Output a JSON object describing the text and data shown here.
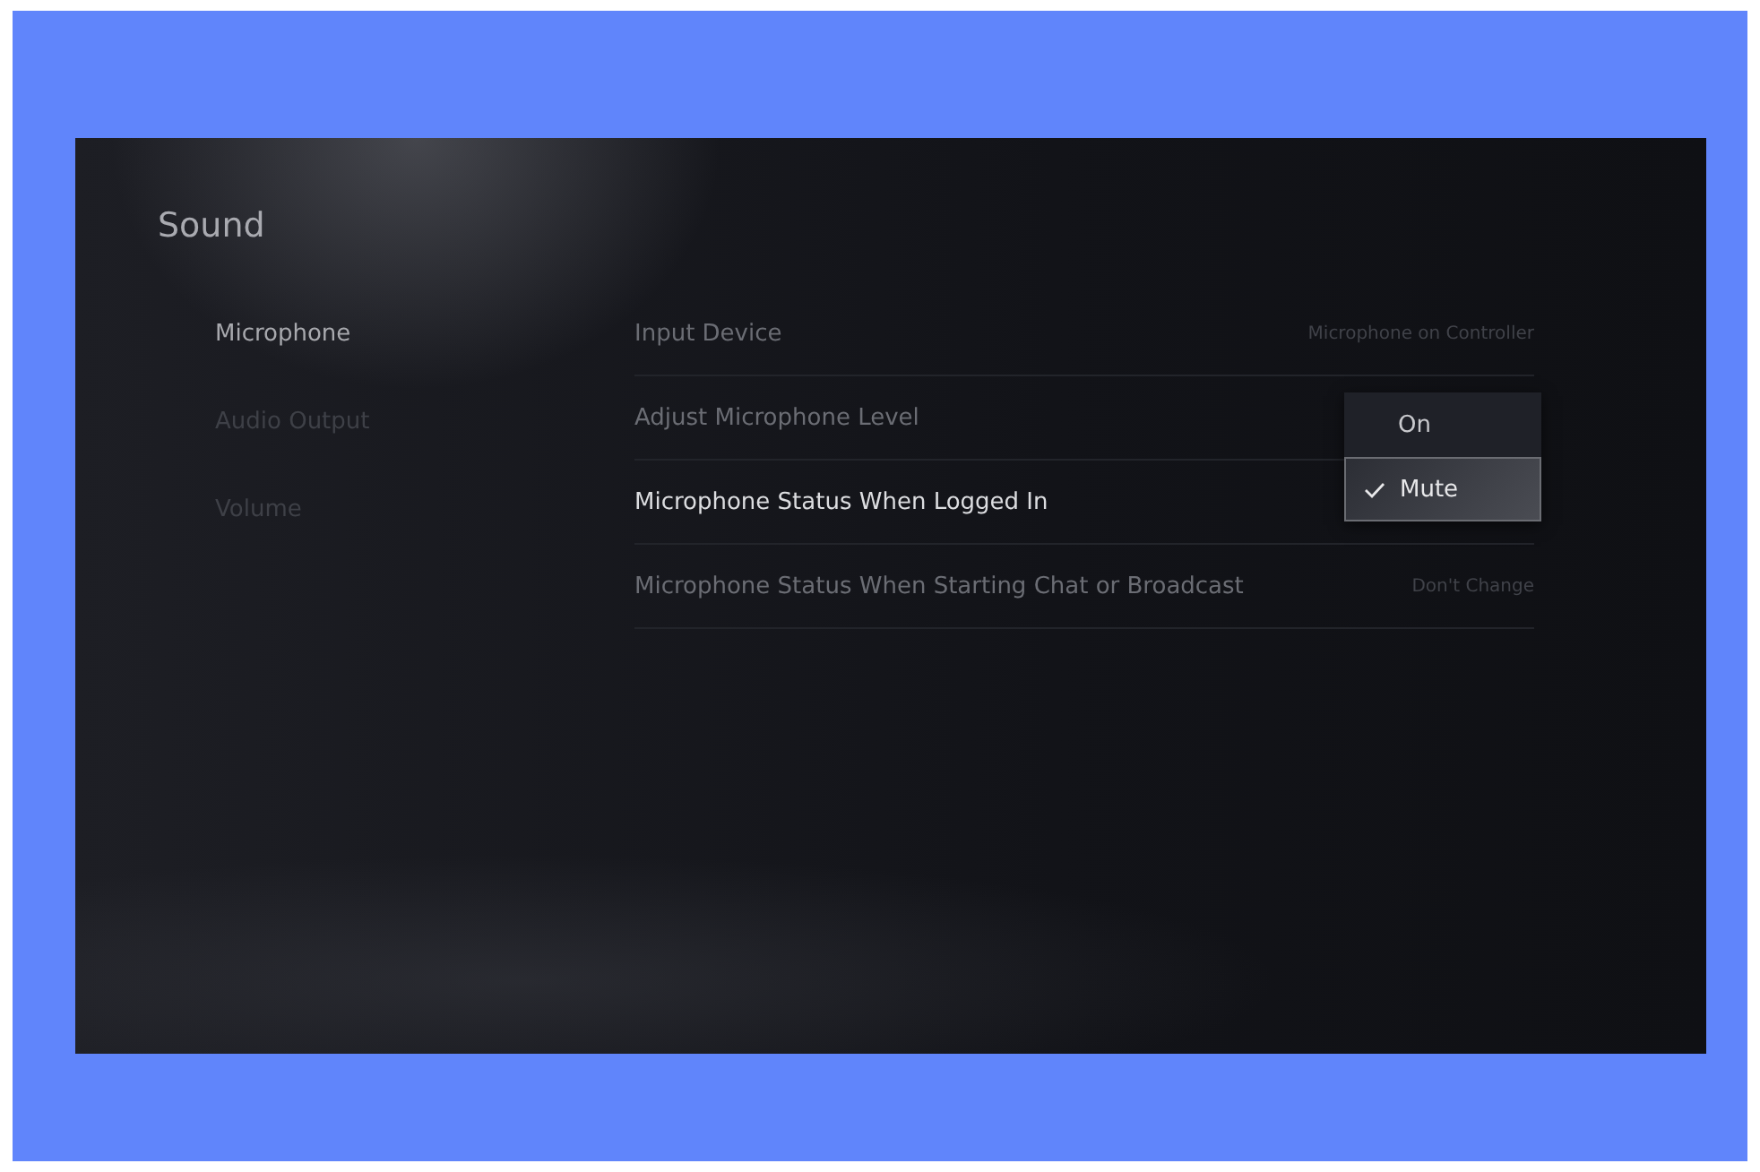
{
  "screen": {
    "title": "Sound"
  },
  "sidebar": {
    "items": [
      {
        "label": "Microphone",
        "selected": true
      },
      {
        "label": "Audio Output",
        "selected": false
      },
      {
        "label": "Volume",
        "selected": false
      }
    ]
  },
  "settings": [
    {
      "label": "Input Device",
      "value": "Microphone on Controller",
      "selected": false
    },
    {
      "label": "Adjust Microphone Level",
      "selected": false
    },
    {
      "label": "Microphone Status When Logged In",
      "selected": true
    },
    {
      "label": "Microphone Status When Starting Chat or Broadcast",
      "value": "Don't Change",
      "selected": false
    }
  ],
  "dropdown": {
    "options": [
      {
        "label": "On",
        "selected": false
      },
      {
        "label": "Mute",
        "selected": true
      }
    ]
  }
}
